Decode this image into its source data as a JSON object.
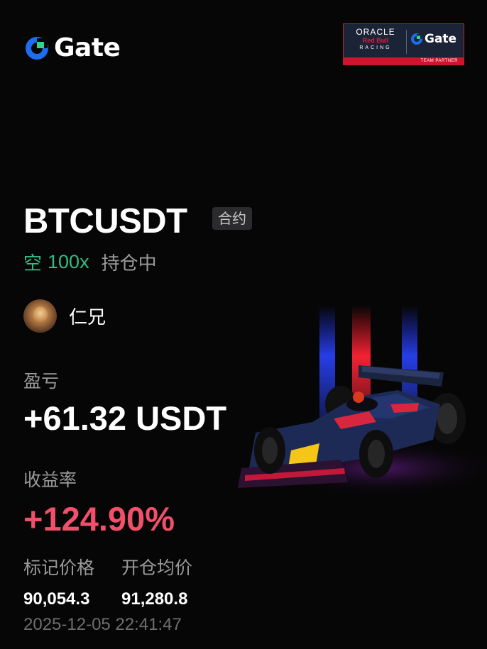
{
  "brand": {
    "name": "Gate",
    "icon": "gate-logo-icon",
    "colors": {
      "blue": "#1e6cf0",
      "green": "#27d98d"
    }
  },
  "partner": {
    "oracle": "ORACLE",
    "redbull": "Red Bull",
    "racing": "RACING",
    "gate": "Gate",
    "strip": "TEAM PARTNER"
  },
  "position": {
    "symbol": "BTCUSDT",
    "type_tag": "合约",
    "side": "空",
    "leverage": "100x",
    "status": "持仓中"
  },
  "user": {
    "name": "仁兄",
    "avatar": "avatar-icon"
  },
  "pnl": {
    "label": "盈亏",
    "value": "+61.32 USDT"
  },
  "roi": {
    "label": "收益率",
    "value": "+124.90%"
  },
  "prices": {
    "mark_label": "标记价格",
    "mark_value": "90,054.3",
    "entry_label": "开仓均价",
    "entry_value": "91,280.8"
  },
  "timestamp": "2025-12-05 22:41:47",
  "colors": {
    "background": "#060606",
    "short_green": "#2fbd85",
    "roi_red": "#f0506a",
    "muted": "#9a9a9a"
  }
}
